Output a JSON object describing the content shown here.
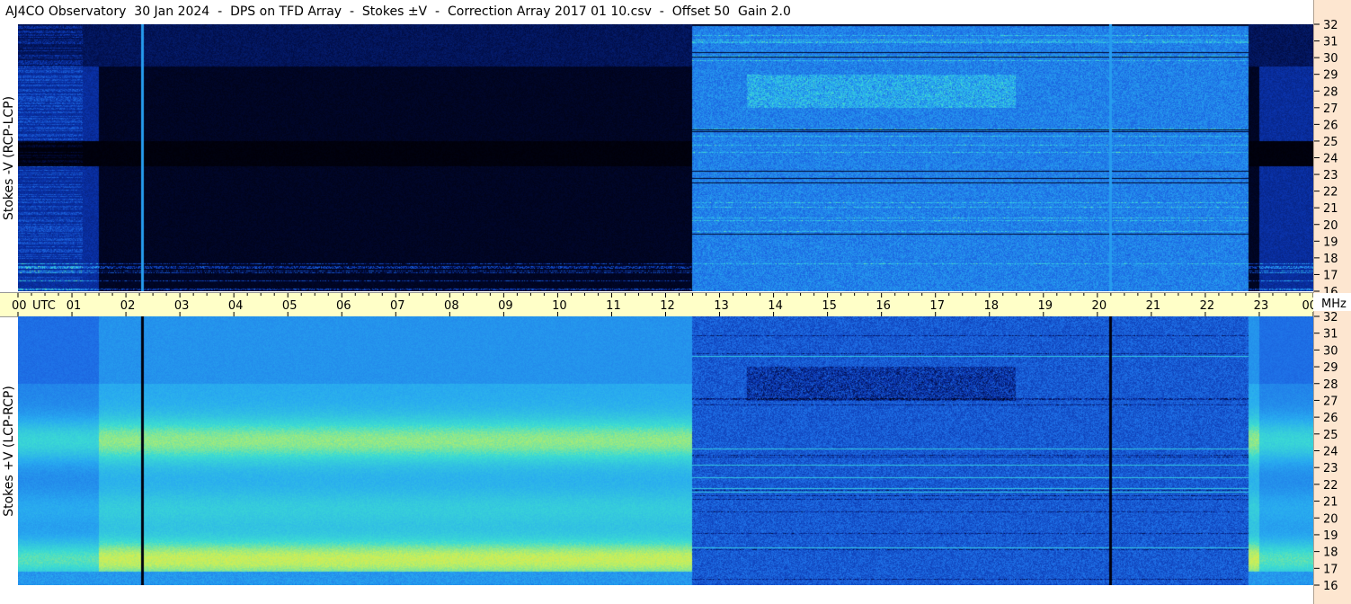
{
  "title": "AJ4CO Observatory  30 Jan 2024  -  DPS on TFD Array  -  Stokes ±V  -  Correction Array 2017 01 10.csv  -  Offset 50  Gain 2.0",
  "chart_data": [
    {
      "type": "heatmap",
      "name": "top-panel",
      "ylabel": "Stokes -V (RCP-LCP)",
      "x_ticks": [
        "00",
        "01",
        "02",
        "03",
        "04",
        "05",
        "06",
        "07",
        "08",
        "09",
        "10",
        "11",
        "12",
        "13",
        "14",
        "15",
        "16",
        "17",
        "18",
        "19",
        "20",
        "21",
        "22",
        "23",
        "00"
      ],
      "x_range_hours": [
        0,
        24
      ],
      "y_ticks": [
        16,
        17,
        18,
        19,
        20,
        21,
        22,
        23,
        24,
        25,
        26,
        27,
        28,
        29,
        30,
        31,
        32
      ],
      "y_range_mhz": [
        16,
        32
      ],
      "daytime_start_hour": 12.5,
      "daytime_end_hour": 22.8,
      "vertical_line_hours": [
        2.3,
        20.25
      ],
      "colormap": "dark-blue-to-cyan"
    },
    {
      "type": "heatmap",
      "name": "bottom-panel",
      "ylabel": "Stokes +V (LCP-RCP)",
      "x_ticks": [
        "00",
        "01",
        "02",
        "03",
        "04",
        "05",
        "06",
        "07",
        "08",
        "09",
        "10",
        "11",
        "12",
        "13",
        "14",
        "15",
        "16",
        "17",
        "18",
        "19",
        "20",
        "21",
        "22",
        "23",
        "00"
      ],
      "x_range_hours": [
        0,
        24
      ],
      "y_ticks": [
        16,
        17,
        18,
        19,
        20,
        21,
        22,
        23,
        24,
        25,
        26,
        27,
        28,
        29,
        30,
        31,
        32
      ],
      "y_range_mhz": [
        16,
        32
      ],
      "daytime_start_hour": 12.5,
      "daytime_end_hour": 22.8,
      "vertical_line_hours": [
        2.3,
        20.25
      ],
      "colormap": "cyan-yellow-magenta"
    }
  ],
  "time_axis": {
    "utc_label": "UTC",
    "mhz_label": "MHz"
  }
}
